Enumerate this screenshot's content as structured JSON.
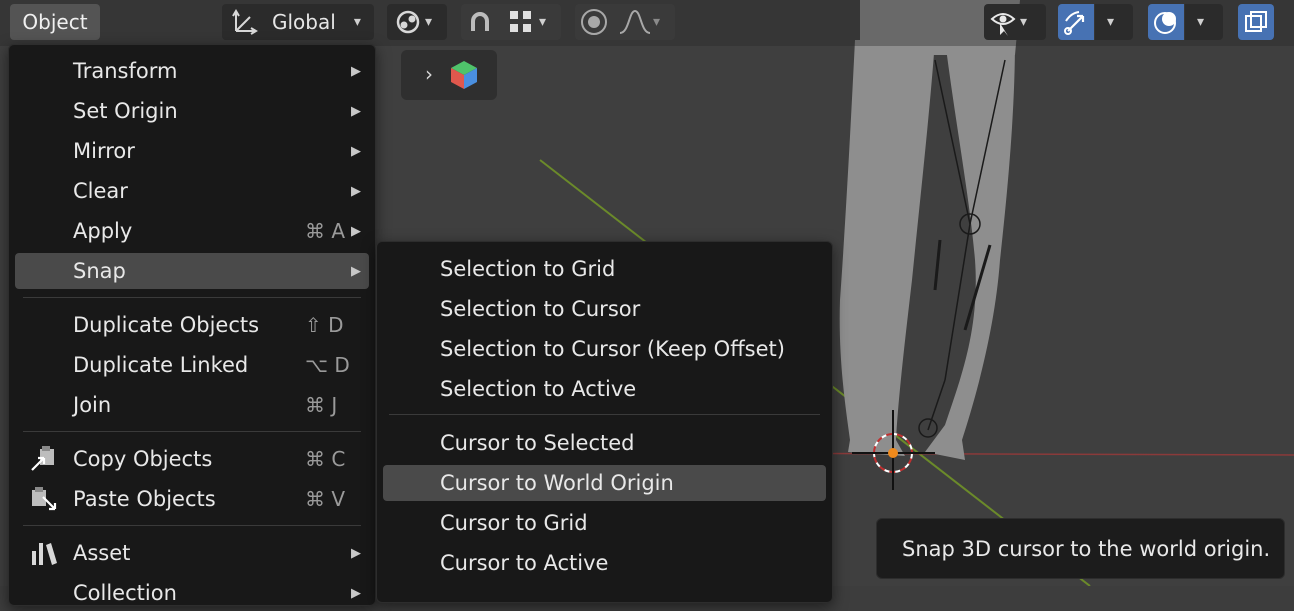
{
  "header": {
    "menu_object": "Object",
    "orientation_label": "Global"
  },
  "object_menu": {
    "items": [
      {
        "label": "Transform",
        "shortcut": "",
        "submenu": true
      },
      {
        "label": "Set Origin",
        "shortcut": "",
        "submenu": true
      },
      {
        "label": "Mirror",
        "shortcut": "",
        "submenu": true
      },
      {
        "label": "Clear",
        "shortcut": "",
        "submenu": true
      },
      {
        "label": "Apply",
        "shortcut": "⌘ A",
        "submenu": true
      },
      {
        "label": "Snap",
        "shortcut": "",
        "submenu": true
      },
      {
        "label": "Duplicate Objects",
        "shortcut": "⇧ D",
        "submenu": false
      },
      {
        "label": "Duplicate Linked",
        "shortcut": "⌥ D",
        "submenu": false
      },
      {
        "label": "Join",
        "shortcut": "⌘ J",
        "submenu": false
      },
      {
        "label": "Copy Objects",
        "shortcut": "⌘ C",
        "submenu": false,
        "icon": "copy-objects-icon"
      },
      {
        "label": "Paste Objects",
        "shortcut": "⌘ V",
        "submenu": false,
        "icon": "paste-objects-icon"
      },
      {
        "label": "Asset",
        "shortcut": "",
        "submenu": true,
        "icon": "asset-icon"
      },
      {
        "label": "Collection",
        "shortcut": "",
        "submenu": true
      }
    ]
  },
  "snap_menu": {
    "items": [
      {
        "label": "Selection to Grid"
      },
      {
        "label": "Selection to Cursor"
      },
      {
        "label": "Selection to Cursor (Keep Offset)"
      },
      {
        "label": "Selection to Active"
      },
      {
        "label": "Cursor to Selected"
      },
      {
        "label": "Cursor to World Origin"
      },
      {
        "label": "Cursor to Grid"
      },
      {
        "label": "Cursor to Active"
      }
    ]
  },
  "tooltip": {
    "text": "Snap 3D cursor to the world origin."
  },
  "colors": {
    "accent_blue": "#4772b3",
    "menu_bg": "#181818",
    "highlight": "#4a4a4a",
    "viewport_bg": "#3f3f3f",
    "x_axis_red": "#8a3a3a",
    "y_axis_green": "#6b8a2a"
  }
}
